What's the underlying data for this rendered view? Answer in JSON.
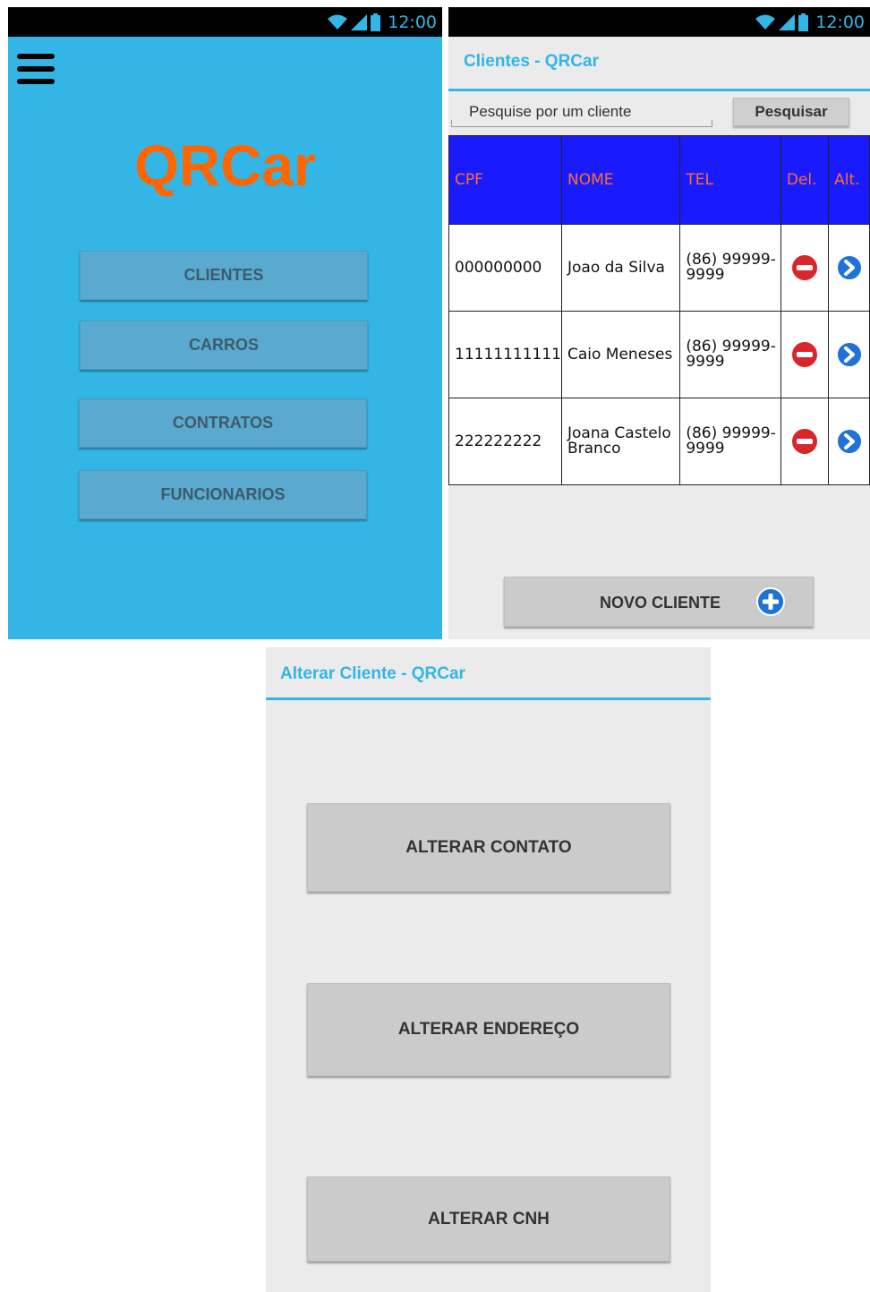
{
  "status_bar": {
    "time": "12:00"
  },
  "menu_screen": {
    "logo": "QRCar",
    "buttons": [
      {
        "label": "CLIENTES"
      },
      {
        "label": "CARROS"
      },
      {
        "label": "CONTRATOS"
      },
      {
        "label": "FUNCIONARIOS"
      }
    ]
  },
  "clientes_screen": {
    "title": "Clientes - QRCar",
    "search": {
      "placeholder": "Pesquise por um cliente",
      "button_label": "Pesquisar"
    },
    "table": {
      "headers": [
        "CPF",
        "NOME",
        "TEL",
        "Del.",
        "Alt."
      ],
      "rows": [
        {
          "cpf": "000000000",
          "nome": "Joao da Silva",
          "tel": "(86) 99999-9999"
        },
        {
          "cpf": "11111111111",
          "nome": "Caio Meneses",
          "tel": "(86) 99999-9999"
        },
        {
          "cpf": "222222222",
          "nome": "Joana Castelo Branco",
          "tel": "(86) 99999-9999"
        }
      ]
    },
    "new_button_label": "NOVO CLIENTE"
  },
  "alterar_screen": {
    "title": "Alterar Cliente - QRCar",
    "buttons": [
      {
        "label": "ALTERAR CONTATO"
      },
      {
        "label": "ALTERAR ENDEREÇO"
      },
      {
        "label": "ALTERAR CNH"
      }
    ]
  },
  "colors": {
    "accent_blue": "#33b5e5",
    "logo_orange": "#ff6600",
    "table_header_bg": "#1a1aff",
    "table_header_text": "#ff6d2d",
    "delete_red": "#d9262b",
    "alter_blue": "#1f73d8"
  },
  "icons": {
    "menu": "hamburger-icon",
    "wifi": "wifi-icon",
    "signal": "signal-icon",
    "battery": "battery-icon",
    "delete": "minus-circle-icon",
    "alter": "chevron-right-circle-icon",
    "add": "plus-circle-icon"
  }
}
